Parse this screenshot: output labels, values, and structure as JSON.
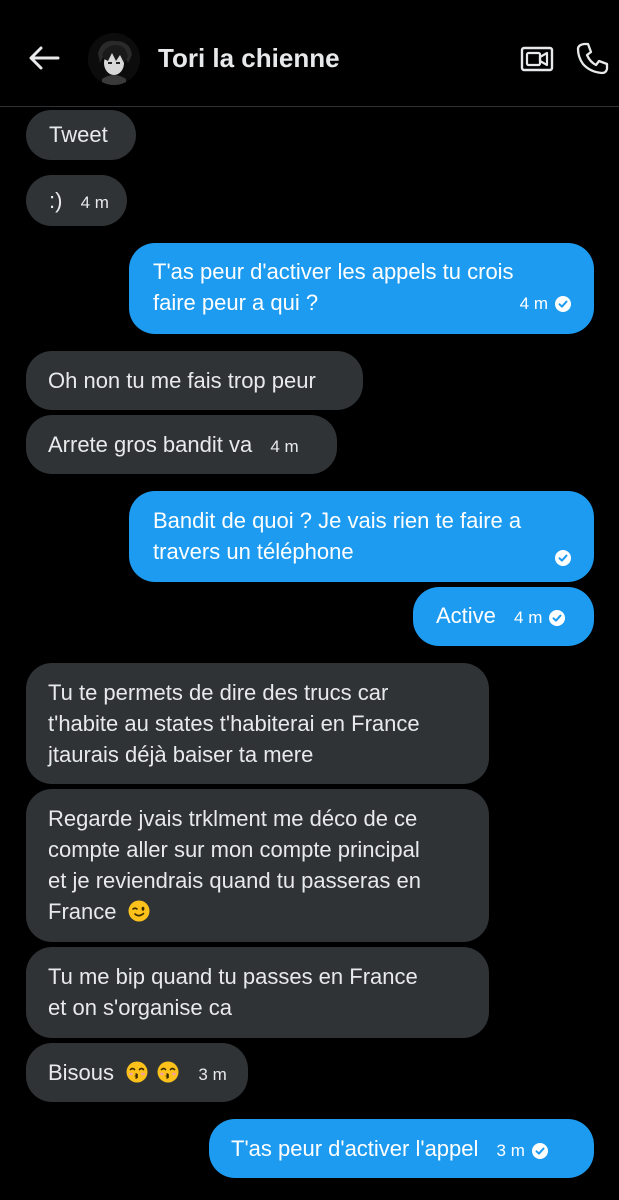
{
  "header": {
    "contact_name": "Tori la chienne",
    "back_icon": "arrow-left-icon",
    "video_icon": "video-call-icon",
    "call_icon": "phone-icon"
  },
  "colors": {
    "background": "#000000",
    "incoming_bubble": "#2f3336",
    "outgoing_bubble": "#1d9bf0",
    "text": "#e7e9ea"
  },
  "messages": [
    {
      "dir": "in",
      "lines": [
        "Tweet"
      ],
      "time": ""
    },
    {
      "dir": "in",
      "lines": [
        ":)"
      ],
      "time": "4 m"
    },
    {
      "dir": "out",
      "lines": [
        "T'as peur d'activer les appels tu crois",
        "faire peur a qui ?"
      ],
      "time": "4 m",
      "read": true
    },
    {
      "dir": "in",
      "lines": [
        "Oh non tu me fais trop peur"
      ],
      "time": ""
    },
    {
      "dir": "in",
      "lines": [
        "Arrete gros bandit va"
      ],
      "time": "4 m"
    },
    {
      "dir": "out",
      "lines": [
        "Bandit de quoi ? Je vais rien te faire a",
        "travers un téléphone"
      ],
      "time": "",
      "read": true
    },
    {
      "dir": "out",
      "lines": [
        "Active"
      ],
      "time": "4 m",
      "read": true
    },
    {
      "dir": "in",
      "lines": [
        "Tu te permets de dire des trucs car",
        "t'habite au states t'habiterai en France",
        "jtaurais déjà baiser ta mere"
      ],
      "time": ""
    },
    {
      "dir": "in",
      "lines": [
        "Regarde jvais trklment me déco de ce",
        "compte aller sur mon compte principal",
        "et je reviendrais quand tu passeras en",
        "France"
      ],
      "time": "",
      "emoji_after_last_line": "winking-face-emoji"
    },
    {
      "dir": "in",
      "lines": [
        "Tu me bip quand tu passes en France",
        "et on s'organise ca"
      ],
      "time": ""
    },
    {
      "dir": "in",
      "lines": [
        "Bisous"
      ],
      "time": "3 m",
      "emojis": [
        "kissing-face-emoji",
        "kissing-face-emoji"
      ]
    },
    {
      "dir": "out",
      "lines": [
        "T'as peur d'activer l'appel"
      ],
      "time": "3 m",
      "read": true
    }
  ]
}
